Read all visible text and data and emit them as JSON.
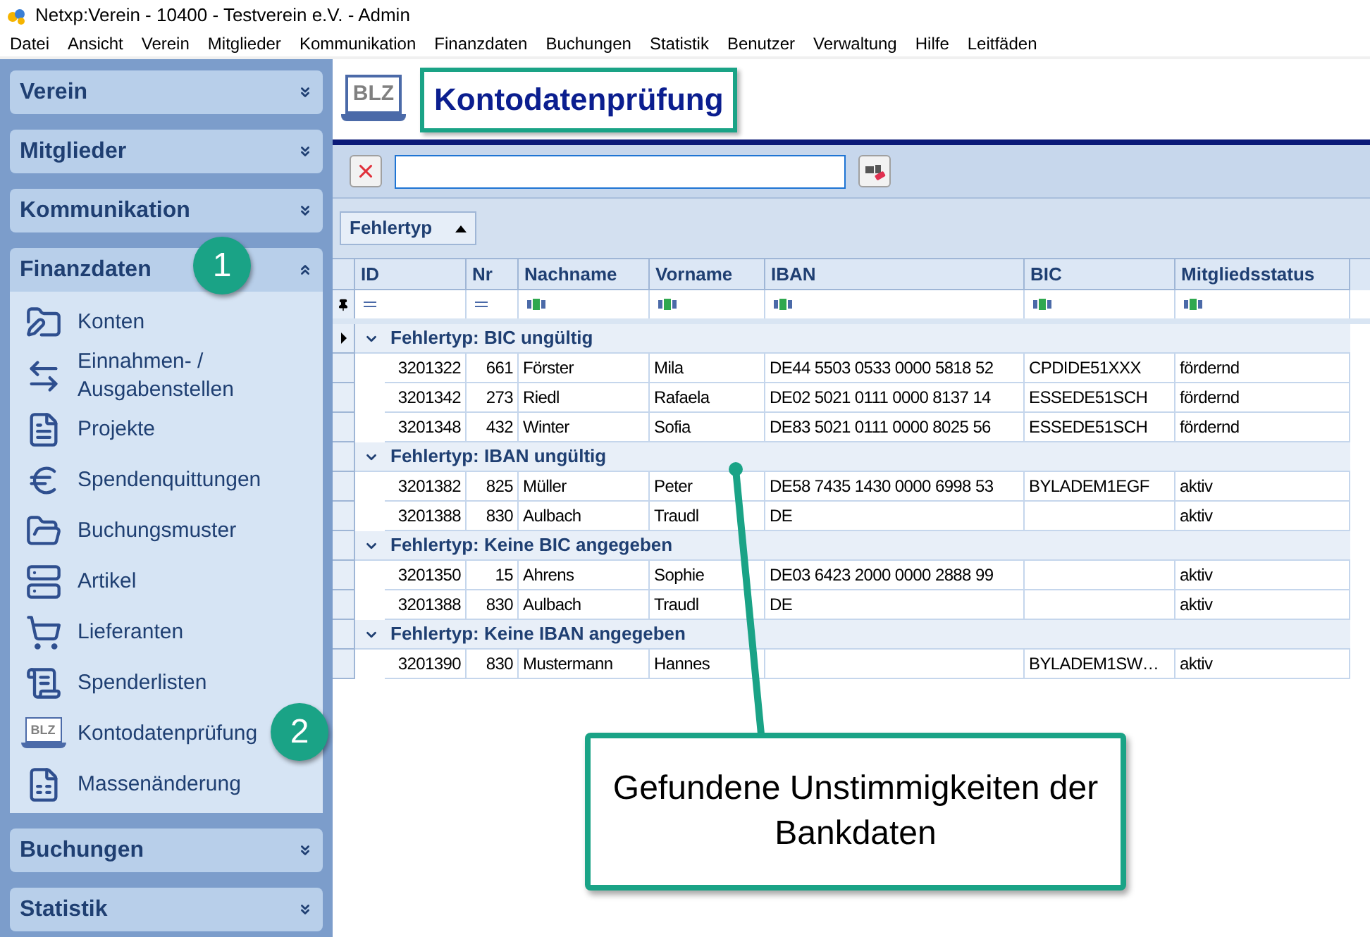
{
  "window": {
    "title": "Netxp:Verein - 10400 - Testverein e.V. - Admin"
  },
  "menu": [
    "Datei",
    "Ansicht",
    "Verein",
    "Mitglieder",
    "Kommunikation",
    "Finanzdaten",
    "Buchungen",
    "Statistik",
    "Benutzer",
    "Verwaltung",
    "Hilfe",
    "Leitfäden"
  ],
  "sidebar": {
    "sections": [
      {
        "title": "Verein",
        "expanded": false
      },
      {
        "title": "Mitglieder",
        "expanded": false
      },
      {
        "title": "Kommunikation",
        "expanded": false
      },
      {
        "title": "Finanzdaten",
        "expanded": true,
        "items": [
          {
            "label": "Konten"
          },
          {
            "label": "Einnahmen- / Ausgabenstellen"
          },
          {
            "label": "Projekte"
          },
          {
            "label": "Spendenquittungen"
          },
          {
            "label": "Buchungsmuster"
          },
          {
            "label": "Artikel"
          },
          {
            "label": "Lieferanten"
          },
          {
            "label": "Spenderlisten"
          },
          {
            "label": "Kontodatenprüfung",
            "icon_text": "BLZ"
          },
          {
            "label": "Massenänderung"
          }
        ]
      },
      {
        "title": "Buchungen",
        "expanded": false
      },
      {
        "title": "Statistik",
        "expanded": false
      }
    ]
  },
  "page": {
    "icon_text": "BLZ",
    "title": "Kontodatenprüfung"
  },
  "group_panel": {
    "label": "Fehlertyp",
    "sort_ascending": true
  },
  "table": {
    "columns": [
      {
        "label": "ID",
        "kind": "number"
      },
      {
        "label": "Nr",
        "kind": "number"
      },
      {
        "label": "Nachname",
        "kind": "text"
      },
      {
        "label": "Vorname",
        "kind": "text"
      },
      {
        "label": "IBAN",
        "kind": "text"
      },
      {
        "label": "BIC",
        "kind": "text"
      },
      {
        "label": "Mitgliedsstatus",
        "kind": "text"
      }
    ],
    "groups": [
      {
        "title": "Fehlertyp: BIC ungültig",
        "expanded": true,
        "selected": true,
        "rows": [
          [
            "3201322",
            "661",
            "Förster",
            "Mila",
            "DE44 5503 0533 0000 5818 52",
            "CPDIDE51XXX",
            "fördernd"
          ],
          [
            "3201342",
            "273",
            "Riedl",
            "Rafaela",
            "DE02 5021 0111 0000 8137 14",
            "ESSEDE51SCH",
            "fördernd"
          ],
          [
            "3201348",
            "432",
            "Winter",
            "Sofia",
            "DE83 5021 0111 0000 8025 56",
            "ESSEDE51SCH",
            "fördernd"
          ]
        ]
      },
      {
        "title": "Fehlertyp: IBAN ungültig",
        "expanded": true,
        "selected": false,
        "rows": [
          [
            "3201382",
            "825",
            "Müller",
            "Peter",
            "DE58 7435 1430 0000 6998 53",
            "BYLADEM1EGF",
            "aktiv"
          ],
          [
            "3201388",
            "830",
            "Aulbach",
            "Traudl",
            "DE",
            "",
            "aktiv"
          ]
        ]
      },
      {
        "title": "Fehlertyp: Keine BIC angegeben",
        "expanded": true,
        "selected": false,
        "rows": [
          [
            "3201350",
            "15",
            "Ahrens",
            "Sophie",
            "DE03 6423 2000 0000 2888 99",
            "",
            "aktiv"
          ],
          [
            "3201388",
            "830",
            "Aulbach",
            "Traudl",
            "DE",
            "",
            "aktiv"
          ]
        ]
      },
      {
        "title": "Fehlertyp: Keine IBAN angegeben",
        "expanded": true,
        "selected": false,
        "rows": [
          [
            "3201390",
            "830",
            "Mustermann",
            "Hannes",
            "",
            "BYLADEM1SW…",
            "aktiv"
          ]
        ]
      }
    ]
  },
  "annotations": {
    "badges": [
      "1",
      "2"
    ],
    "callout": "Gefundene Unstimmigkeiten der Bankdaten"
  }
}
